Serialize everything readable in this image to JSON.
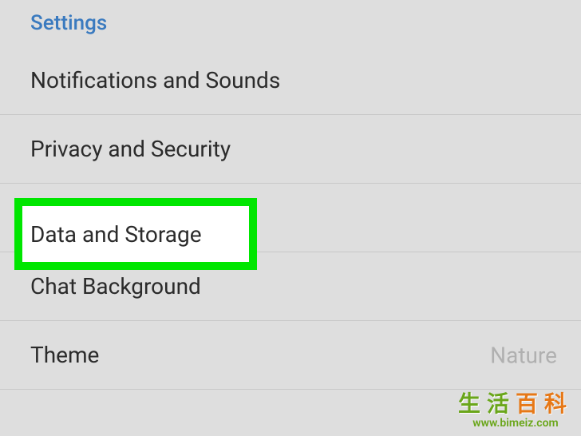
{
  "section_header": "Settings",
  "items": [
    {
      "label": "Notifications and Sounds"
    },
    {
      "label": "Privacy and Security"
    },
    {
      "label": "Data and Storage",
      "highlighted": true
    },
    {
      "label": "Chat Background"
    },
    {
      "label": "Theme",
      "value": "Nature"
    }
  ],
  "watermark": {
    "cn_part1": "生活",
    "cn_part2": "百科",
    "url": "www.bimeiz.com"
  }
}
